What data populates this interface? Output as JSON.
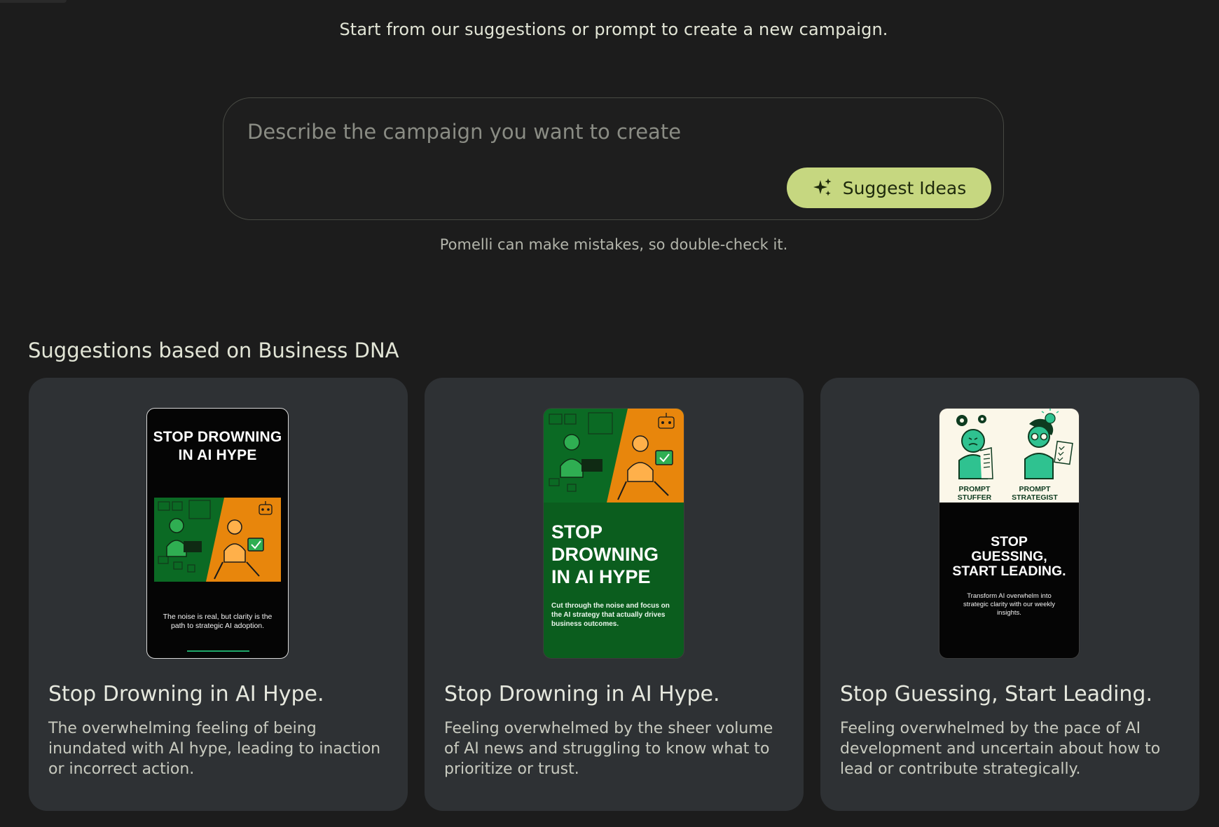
{
  "header": {
    "intro": "Start from our suggestions or prompt to create a new campaign."
  },
  "prompt": {
    "placeholder": "Describe the campaign you want to create",
    "value": "",
    "suggest_button": {
      "label": "Suggest Ideas",
      "icon": "sparkle-icon"
    }
  },
  "disclaimer": "Pomelli can make mistakes, so double-check it.",
  "suggestions": {
    "title": "Suggestions based on Business DNA",
    "cards": [
      {
        "title": "Stop Drowning in AI Hype.",
        "description": "The overwhelming feeling of being inundated with AI hype, leading to inaction or incorrect action.",
        "poster": {
          "headline": "STOP DROWNING IN AI HYPE",
          "caption": "The noise is real, but clarity is the path to strategic AI adoption."
        }
      },
      {
        "title": "Stop Drowning in AI Hype.",
        "description": "Feeling overwhelmed by the sheer volume of AI news and struggling to know what to prioritize or trust.",
        "poster": {
          "headline": "STOP DROWNING IN AI HYPE",
          "caption": "Cut through the noise and focus on the AI strategy that actually drives business outcomes."
        }
      },
      {
        "title": "Stop Guessing, Start Leading.",
        "description": "Feeling overwhelmed by the pace of AI development and uncertain about how to lead or contribute strategically.",
        "poster": {
          "label_left": "PROMPT\nSTUFFER",
          "label_right": "PROMPT\nSTRATEGIST",
          "headline": "STOP\nGUESSING,\nSTART LEADING.",
          "caption": "Transform AI overwhelm into strategic clarity with our weekly insights."
        }
      }
    ]
  },
  "colors": {
    "background": "#1c1c1c",
    "card": "#2e3134",
    "accent_button": "#c6d780",
    "poster_green": "#0b5d1e",
    "poster_orange": "#e8860c",
    "poster_mint": "#2fc290"
  }
}
